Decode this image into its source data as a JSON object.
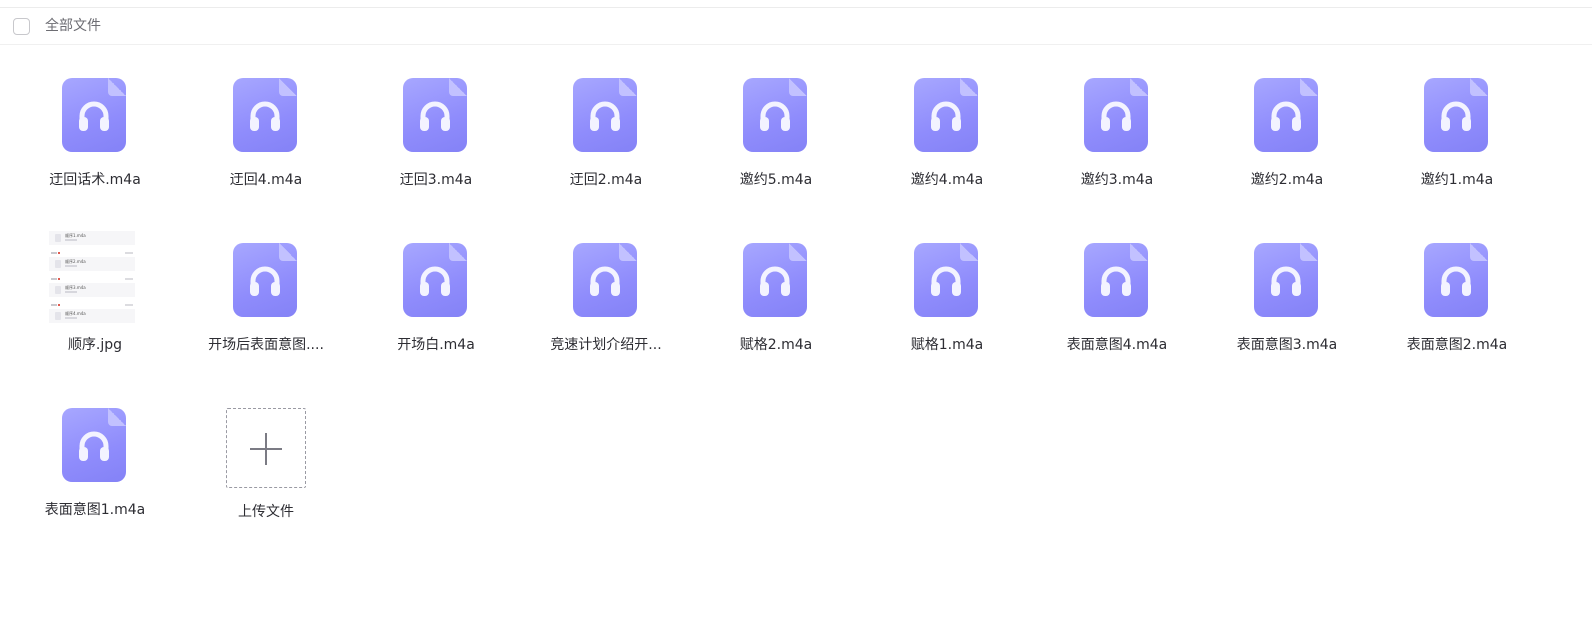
{
  "header": {
    "select_all_label": "全部文件"
  },
  "files": [
    {
      "name": "迂回话术.m4a",
      "type": "audio",
      "icon": "headphones-icon"
    },
    {
      "name": "迂回4.m4a",
      "type": "audio",
      "icon": "headphones-icon"
    },
    {
      "name": "迂回3.m4a",
      "type": "audio",
      "icon": "headphones-icon"
    },
    {
      "name": "迂回2.m4a",
      "type": "audio",
      "icon": "headphones-icon"
    },
    {
      "name": "邀约5.m4a",
      "type": "audio",
      "icon": "headphones-icon"
    },
    {
      "name": "邀约4.m4a",
      "type": "audio",
      "icon": "headphones-icon"
    },
    {
      "name": "邀约3.m4a",
      "type": "audio",
      "icon": "headphones-icon"
    },
    {
      "name": "邀约2.m4a",
      "type": "audio",
      "icon": "headphones-icon"
    },
    {
      "name": "邀约1.m4a",
      "type": "audio",
      "icon": "headphones-icon"
    },
    {
      "name": "顺序.jpg",
      "type": "image",
      "icon": "image-thumbnail"
    },
    {
      "name": "开场后表面意图....",
      "type": "audio",
      "icon": "headphones-icon"
    },
    {
      "name": "开场白.m4a",
      "type": "audio",
      "icon": "headphones-icon"
    },
    {
      "name": "竞速计划介绍开...",
      "type": "audio",
      "icon": "headphones-icon"
    },
    {
      "name": "赋格2.m4a",
      "type": "audio",
      "icon": "headphones-icon"
    },
    {
      "name": "赋格1.m4a",
      "type": "audio",
      "icon": "headphones-icon"
    },
    {
      "name": "表面意图4.m4a",
      "type": "audio",
      "icon": "headphones-icon"
    },
    {
      "name": "表面意图3.m4a",
      "type": "audio",
      "icon": "headphones-icon"
    },
    {
      "name": "表面意图2.m4a",
      "type": "audio",
      "icon": "headphones-icon"
    },
    {
      "name": "表面意图1.m4a",
      "type": "audio",
      "icon": "headphones-icon"
    }
  ],
  "thumbnail_rows": [
    "顺序1.m4a",
    "顺序2.m4a",
    "顺序3.m4a",
    "顺序4.m4a"
  ],
  "upload": {
    "label": "上传文件",
    "icon": "plus-icon"
  },
  "colors": {
    "audio_icon_gradient_start": "#a7a7ff",
    "audio_icon_gradient_end": "#8482f6",
    "text": "#2d2d33",
    "muted_text": "#6d6d73"
  }
}
